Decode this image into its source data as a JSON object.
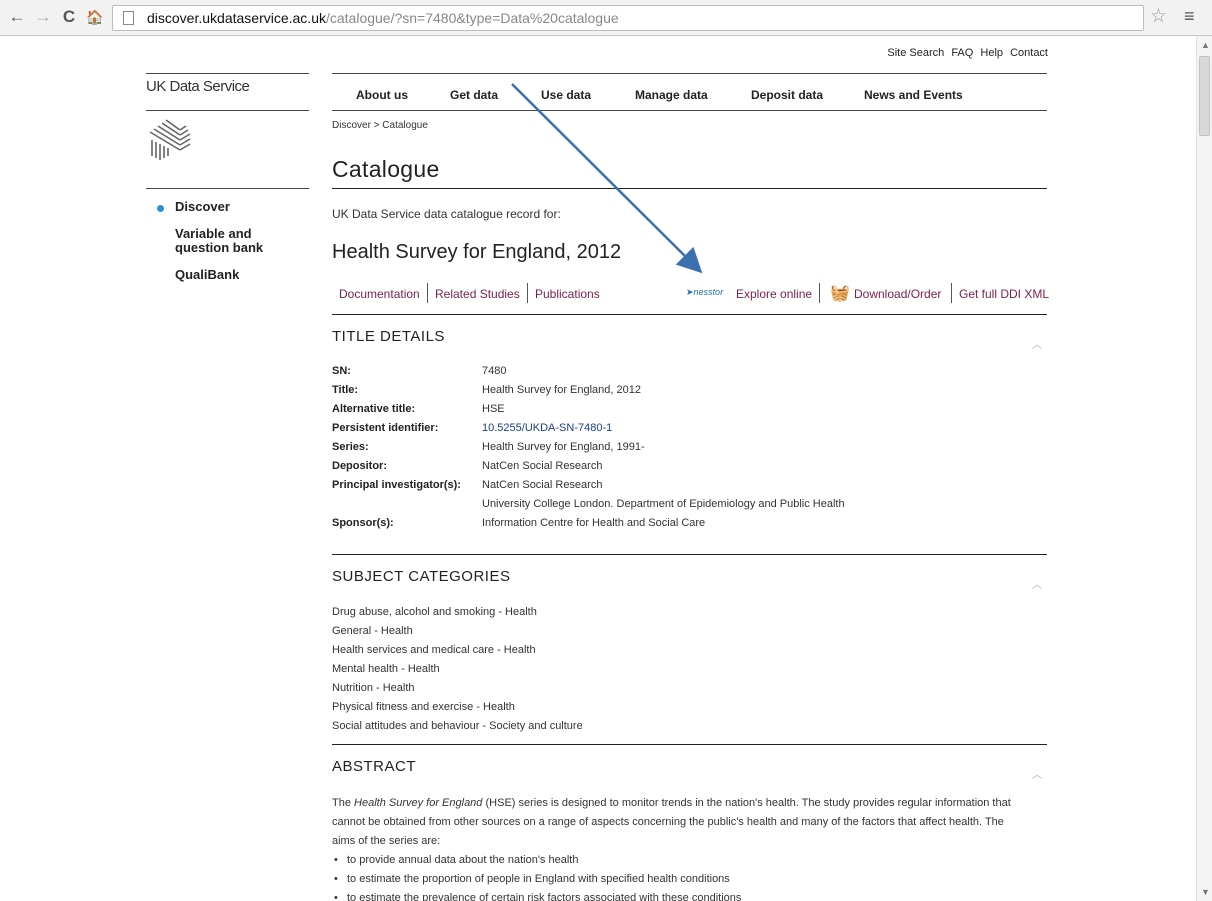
{
  "browser": {
    "url_host": "discover.ukdataservice.ac.uk",
    "url_path": "/catalogue/?sn=7480&type=Data%20catalogue",
    "back_glyph": "←",
    "forward_glyph": "→",
    "reload_glyph": "C",
    "home_glyph": "🏠",
    "star_glyph": "☆",
    "menu_glyph": "≡"
  },
  "site": {
    "top_links": [
      "Site Search",
      "FAQ",
      "Help",
      "Contact"
    ],
    "brand": "UK Data Service",
    "main_nav": [
      "About us",
      "Get data",
      "Use data",
      "Manage data",
      "Deposit data",
      "News and Events"
    ],
    "breadcrumb": "Discover > Catalogue",
    "page_title": "Catalogue"
  },
  "sidebar": {
    "items": [
      "Discover",
      "Variable and question bank",
      "QualiBank"
    ],
    "item2_line1": "Variable and",
    "item2_line2": "question bank"
  },
  "record": {
    "intro": "UK Data Service data catalogue record for:",
    "title": "Health Survey for England, 2012",
    "tabs_left": [
      "Documentation",
      "Related Studies",
      "Publications"
    ],
    "nesstor_label": "nesstor",
    "explore": "Explore online",
    "download": "Download/Order",
    "ddi": "Get full DDI XML"
  },
  "title_details": {
    "heading": "TITLE DETAILS",
    "rows": [
      {
        "key": "SN:",
        "value": "7480"
      },
      {
        "key": "Title:",
        "value": "Health Survey for England, 2012"
      },
      {
        "key": "Alternative title:",
        "value": "HSE"
      },
      {
        "key": "Persistent identifier:",
        "value": "10.5255/UKDA-SN-7480-1"
      },
      {
        "key": "Series:",
        "value": "Health Survey for England, 1991-"
      },
      {
        "key": "Depositor:",
        "value": "NatCen Social Research"
      },
      {
        "key": "Principal investigator(s):",
        "value": "NatCen Social Research"
      },
      {
        "key": "",
        "value": "University College London. Department of Epidemiology and Public Health"
      },
      {
        "key": "Sponsor(s):",
        "value": "Information Centre for Health and Social Care"
      }
    ]
  },
  "subject_categories": {
    "heading": "SUBJECT CATEGORIES",
    "items": [
      "Drug abuse, alcohol and smoking - Health",
      "General - Health",
      "Health services and medical care - Health",
      "Mental health - Health",
      "Nutrition - Health",
      "Physical fitness and exercise - Health",
      "Social attitudes and behaviour - Society and culture"
    ]
  },
  "abstract": {
    "heading": "ABSTRACT",
    "p1_pre": "The ",
    "p1_em": "Health Survey for England",
    "p1_post": " (HSE) series is designed to monitor trends in the nation's health. The study provides regular information that",
    "p2": "cannot be obtained from other sources on a range of aspects concerning the public's health and many of the factors that affect health. The",
    "p3": "aims of the series are:",
    "bullets": [
      "to provide annual data about the nation's health",
      "to estimate the proportion of people in England with specified health conditions",
      "to estimate the prevalence of certain risk factors associated with these conditions"
    ]
  },
  "colors": {
    "link_maroon": "#7a1f4b",
    "link_blue": "#1a3f8a",
    "annotation_arrow": "#3a6fb0",
    "active_dot": "#2a8fd6"
  }
}
